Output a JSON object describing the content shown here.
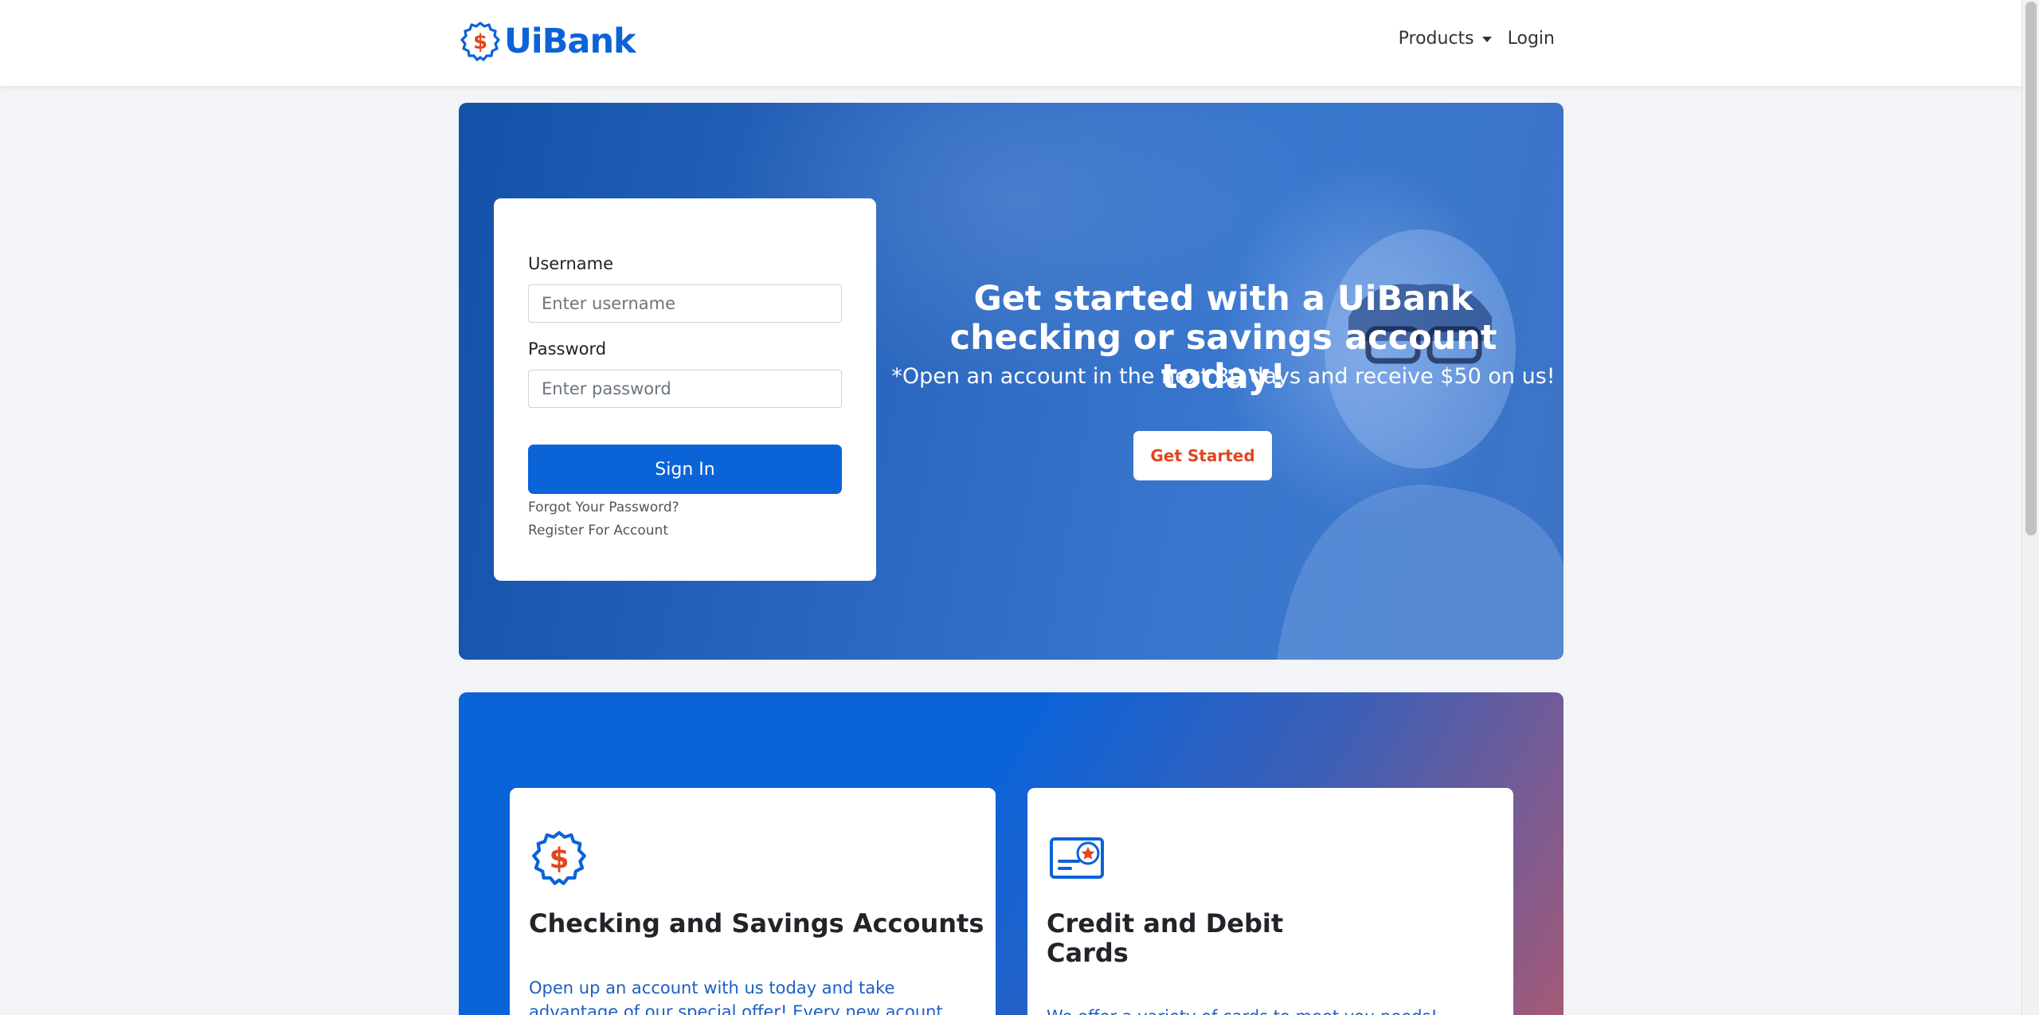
{
  "colors": {
    "brand_blue": "#0b63d8",
    "accent_orange": "#e2461f",
    "page_bg": "#f3f4f7"
  },
  "navbar": {
    "brand_name": "UiBank",
    "brand_icon": "dollar-badge-icon",
    "products_label": "Products",
    "login_label": "Login"
  },
  "login": {
    "username_label": "Username",
    "username_placeholder": "Enter username",
    "password_label": "Password",
    "password_placeholder": "Enter password",
    "signin_label": "Sign In",
    "forgot_label": "Forgot Your Password?",
    "register_label": "Register For Account"
  },
  "hero": {
    "title": "Get started with a UiBank checking or savings account today!",
    "subtitle": "*Open an account in the next 30 days and receive $50 on us!",
    "cta_label": "Get Started"
  },
  "products": [
    {
      "icon": "dollar-badge-icon",
      "title": "Checking and Savings Accounts",
      "description": "Open up an account with us today and take advantage of our special offer! Every new acount created with us in"
    },
    {
      "icon": "credit-card-star-icon",
      "title_line1": "Credit and Debit",
      "title_line2": "Cards",
      "description": "We offer a variety of cards to meet you needs! Whether"
    }
  ]
}
